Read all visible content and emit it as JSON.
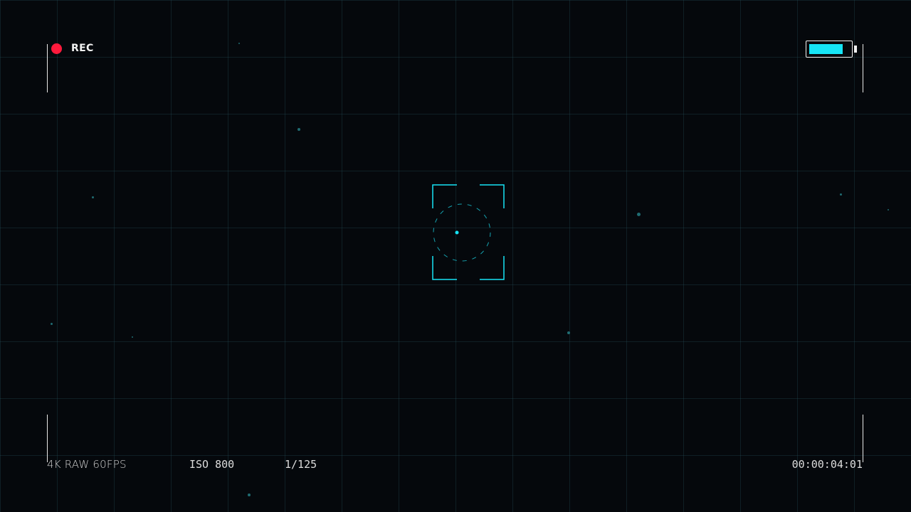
{
  "recording": {
    "label": "REC",
    "dot_color": "#ff1a3c"
  },
  "battery": {
    "level": 0.85,
    "fill_color": "#16e4f5"
  },
  "hud": {
    "format": "4K RAW 60FPS",
    "iso": "ISO 800",
    "shutter": "1/125",
    "timecode": "00:00:04:01"
  },
  "icons": {
    "recording": "record-dot-icon",
    "battery": "battery-icon",
    "focus": "focus-reticle-icon"
  },
  "colors": {
    "accent": "#16e4f5",
    "frame": "#e8e8e8",
    "background": "#05080c"
  }
}
